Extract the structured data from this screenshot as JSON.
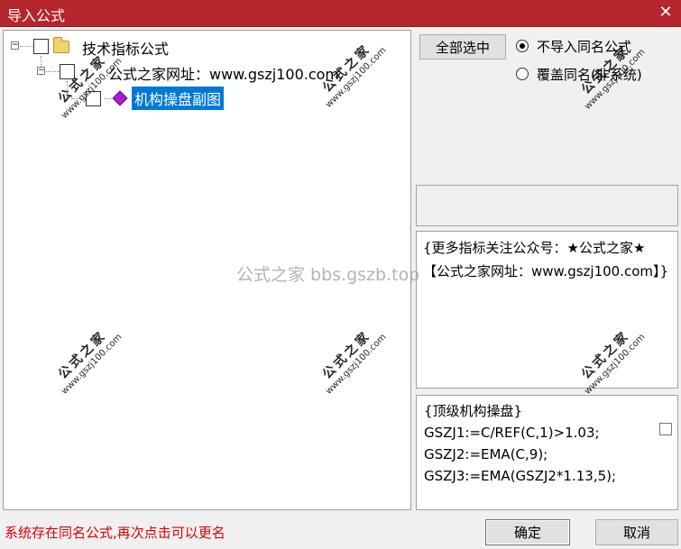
{
  "window": {
    "title": "导入公式",
    "close_glyph": "✕"
  },
  "tree": {
    "root": {
      "label": "技术指标公式",
      "expander": "⊟",
      "icon": "folder-icon"
    },
    "child": {
      "label": "公式之家网址：www.gszj100.com",
      "expander": "⊟"
    },
    "leaf": {
      "label": "机构操盘副图",
      "icon": "diamond-indicator-icon",
      "selected": true
    }
  },
  "options": {
    "select_all_label": "全部选中",
    "radio_skip_label": "不导入同名公式",
    "radio_overwrite_label": "覆盖同名(非系统)",
    "selected": "skip"
  },
  "description": {
    "text": "{更多指标关注公众号：★公式之家★ 【公式之家网址：www.gszj100.com】}"
  },
  "code": {
    "lines": [
      "{顶级机构操盘}",
      "GSZJ1:=C/REF(C,1)>1.03;",
      "GSZJ2:=EMA(C,9);",
      "GSZJ3:=EMA(GSZJ2*1.13,5);"
    ]
  },
  "status": {
    "message": "系统存在同名公式,再次点击可以更名",
    "color": "#e00000"
  },
  "buttons": {
    "ok_label": "确定",
    "cancel_label": "取消"
  },
  "watermark": {
    "center_text": "公式之家 bbs.gszb.top",
    "stamp_title": "公式之家",
    "stamp_url": "www.gszj100.com"
  },
  "colors": {
    "titlebar": "#b5252c",
    "selection": "#0078d7"
  }
}
